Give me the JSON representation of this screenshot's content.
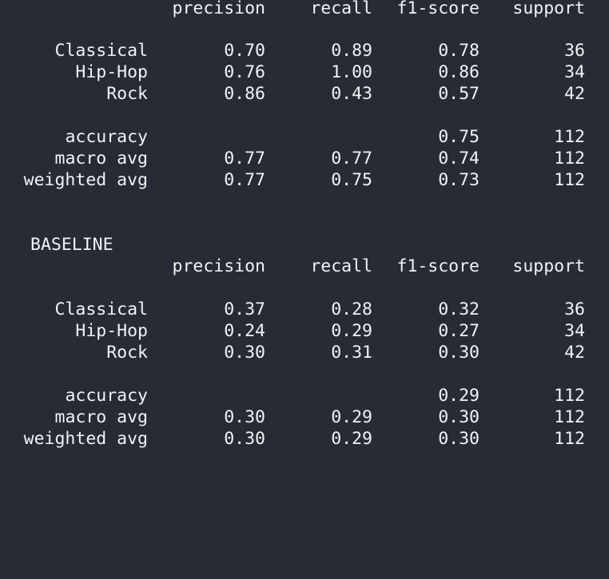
{
  "reports": [
    {
      "title": "",
      "header": {
        "precision": "precision",
        "recall": "recall",
        "f1": "f1-score",
        "support": "support"
      },
      "classes": [
        {
          "label": "Classical",
          "precision": "0.70",
          "recall": "0.89",
          "f1": "0.78",
          "support": "36"
        },
        {
          "label": "Hip-Hop",
          "precision": "0.76",
          "recall": "1.00",
          "f1": "0.86",
          "support": "34"
        },
        {
          "label": "Rock",
          "precision": "0.86",
          "recall": "0.43",
          "f1": "0.57",
          "support": "42"
        }
      ],
      "summary": [
        {
          "label": "accuracy",
          "precision": "",
          "recall": "",
          "f1": "0.75",
          "support": "112"
        },
        {
          "label": "macro avg",
          "precision": "0.77",
          "recall": "0.77",
          "f1": "0.74",
          "support": "112"
        },
        {
          "label": "weighted avg",
          "precision": "0.77",
          "recall": "0.75",
          "f1": "0.73",
          "support": "112"
        }
      ]
    },
    {
      "title": "BASELINE",
      "header": {
        "precision": "precision",
        "recall": "recall",
        "f1": "f1-score",
        "support": "support"
      },
      "classes": [
        {
          "label": "Classical",
          "precision": "0.37",
          "recall": "0.28",
          "f1": "0.32",
          "support": "36"
        },
        {
          "label": "Hip-Hop",
          "precision": "0.24",
          "recall": "0.29",
          "f1": "0.27",
          "support": "34"
        },
        {
          "label": "Rock",
          "precision": "0.30",
          "recall": "0.31",
          "f1": "0.30",
          "support": "42"
        }
      ],
      "summary": [
        {
          "label": "accuracy",
          "precision": "",
          "recall": "",
          "f1": "0.29",
          "support": "112"
        },
        {
          "label": "macro avg",
          "precision": "0.30",
          "recall": "0.29",
          "f1": "0.30",
          "support": "112"
        },
        {
          "label": "weighted avg",
          "precision": "0.30",
          "recall": "0.29",
          "f1": "0.30",
          "support": "112"
        }
      ]
    }
  ]
}
